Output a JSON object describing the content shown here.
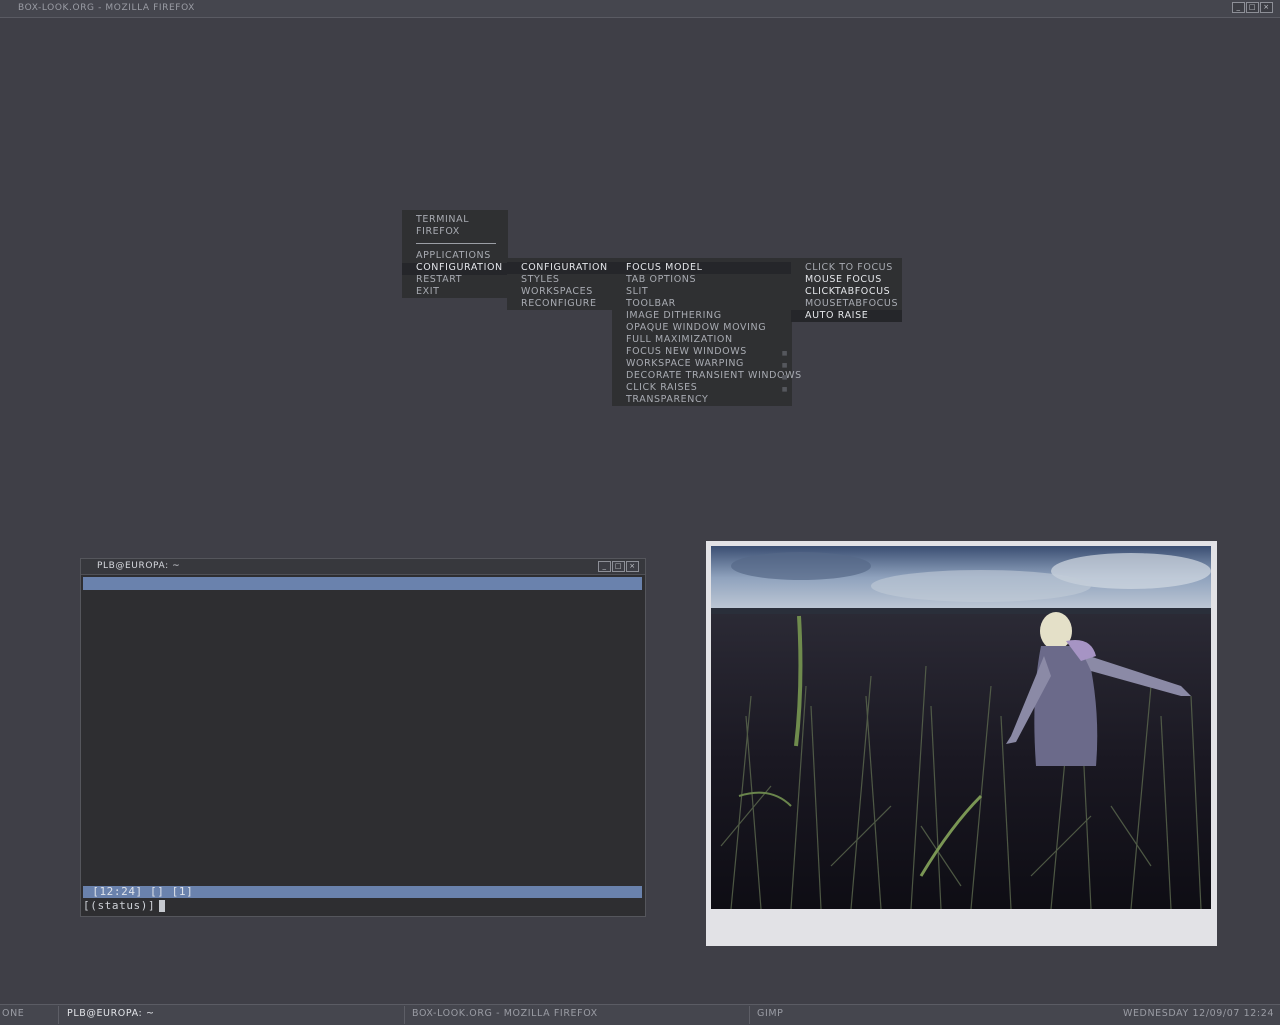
{
  "window_title": "BOX-LOOK.ORG - MOZILLA FIREFOX",
  "root_menu": {
    "items": [
      "TERMINAL",
      "FIREFOX",
      "APPLICATIONS",
      "CONFIGURATION",
      "RESTART",
      "EXIT"
    ]
  },
  "config_menu": {
    "items": [
      "CONFIGURATION",
      "STYLES",
      "WORKSPACES",
      "RECONFIGURE"
    ]
  },
  "focus_menu": {
    "items": [
      "FOCUS MODEL",
      "TAB OPTIONS",
      "SLIT",
      "TOOLBAR",
      "IMAGE DITHERING",
      "OPAQUE WINDOW MOVING",
      "FULL MAXIMIZATION",
      "FOCUS NEW WINDOWS",
      "WORKSPACE WARPING",
      "DECORATE TRANSIENT WINDOWS",
      "CLICK RAISES",
      "TRANSPARENCY"
    ]
  },
  "focus_model_menu": {
    "items": [
      "CLICK TO FOCUS",
      "MOUSE FOCUS",
      "CLICKTABFOCUS",
      "MOUSETABFOCUS",
      "AUTO RAISE"
    ]
  },
  "terminal": {
    "title": "PLB@EUROPA: ~",
    "status_line": " [12:24] [] [1]",
    "prompt": "[(status)]"
  },
  "taskbar": {
    "workspace": "ONE",
    "task_active": "PLB@EUROPA: ~",
    "task_firefox": "BOX-LOOK.ORG - MOZILLA FIREFOX",
    "task_gimp": "GIMP",
    "clock": "WEDNESDAY 12/09/07 12:24"
  },
  "colors": {
    "desktop": "#3f3f47",
    "menu_bg": "#2f3032",
    "accent_blue": "#6a82ad",
    "photo_frame": "#e2e2e6"
  },
  "icons": [
    "minimize-icon",
    "maximize-icon",
    "close-icon"
  ]
}
